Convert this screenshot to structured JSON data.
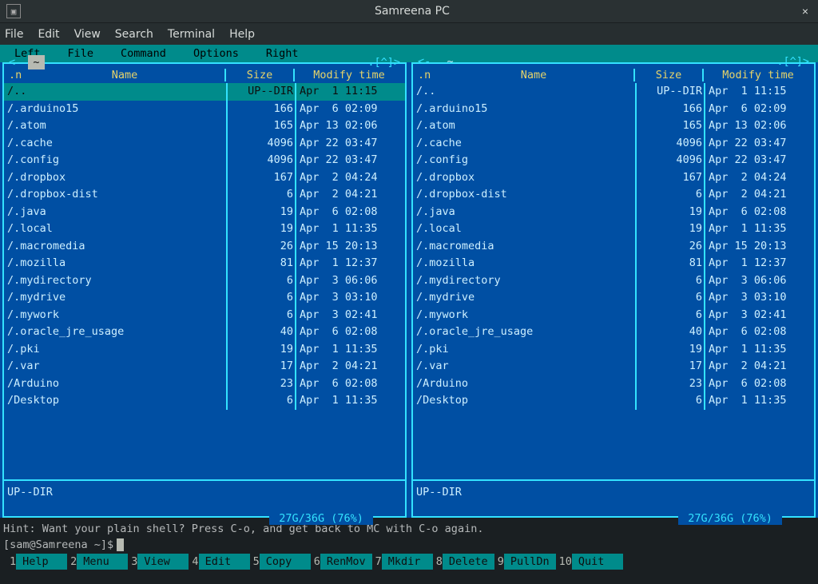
{
  "window": {
    "title": "Samreena PC",
    "close": "×"
  },
  "term_menu": [
    "File",
    "Edit",
    "View",
    "Search",
    "Terminal",
    "Help"
  ],
  "mc_menu": [
    "Left",
    "File",
    "Command",
    "Options",
    "Right"
  ],
  "panel_header": {
    "caret": ".[^]>",
    "dash_left_active": "<-",
    "dash_right": "-",
    "path_left": "~",
    "path_right": "~",
    "dash_left_inactive": "<- "
  },
  "columns": {
    "n": ".n",
    "name": "Name",
    "size": "Size",
    "modify": "Modify time"
  },
  "files": [
    {
      "name": "/..",
      "size": "UP--DIR",
      "mod": "Apr  1 11:15",
      "hl_left": true
    },
    {
      "name": "/.arduino15",
      "size": "166",
      "mod": "Apr  6 02:09"
    },
    {
      "name": "/.atom",
      "size": "165",
      "mod": "Apr 13 02:06"
    },
    {
      "name": "/.cache",
      "size": "4096",
      "mod": "Apr 22 03:47"
    },
    {
      "name": "/.config",
      "size": "4096",
      "mod": "Apr 22 03:47"
    },
    {
      "name": "/.dropbox",
      "size": "167",
      "mod": "Apr  2 04:24"
    },
    {
      "name": "/.dropbox-dist",
      "size": "6",
      "mod": "Apr  2 04:21"
    },
    {
      "name": "/.java",
      "size": "19",
      "mod": "Apr  6 02:08"
    },
    {
      "name": "/.local",
      "size": "19",
      "mod": "Apr  1 11:35"
    },
    {
      "name": "/.macromedia",
      "size": "26",
      "mod": "Apr 15 20:13"
    },
    {
      "name": "/.mozilla",
      "size": "81",
      "mod": "Apr  1 12:37"
    },
    {
      "name": "/.mydirectory",
      "size": "6",
      "mod": "Apr  3 06:06"
    },
    {
      "name": "/.mydrive",
      "size": "6",
      "mod": "Apr  3 03:10"
    },
    {
      "name": "/.mywork",
      "size": "6",
      "mod": "Apr  3 02:41"
    },
    {
      "name": "/.oracle_jre_usage",
      "size": "40",
      "mod": "Apr  6 02:08"
    },
    {
      "name": "/.pki",
      "size": "19",
      "mod": "Apr  1 11:35"
    },
    {
      "name": "/.var",
      "size": "17",
      "mod": "Apr  2 04:21"
    },
    {
      "name": "/Arduino",
      "size": "23",
      "mod": "Apr  6 02:08"
    },
    {
      "name": "/Desktop",
      "size": "6",
      "mod": "Apr  1 11:35"
    }
  ],
  "mini_status": "UP--DIR",
  "disk": " 27G/36G (76%) ",
  "hint": "Hint: Want your plain shell? Press C-o, and get back to MC with C-o again.",
  "prompt": "[sam@Samreena ~]$",
  "fnkeys": [
    {
      "n": "1",
      "label": "Help"
    },
    {
      "n": "2",
      "label": "Menu"
    },
    {
      "n": "3",
      "label": "View"
    },
    {
      "n": "4",
      "label": "Edit"
    },
    {
      "n": "5",
      "label": "Copy"
    },
    {
      "n": "6",
      "label": "RenMov"
    },
    {
      "n": "7",
      "label": "Mkdir"
    },
    {
      "n": "8",
      "label": "Delete"
    },
    {
      "n": "9",
      "label": "PullDn"
    },
    {
      "n": "10",
      "label": "Quit"
    }
  ]
}
